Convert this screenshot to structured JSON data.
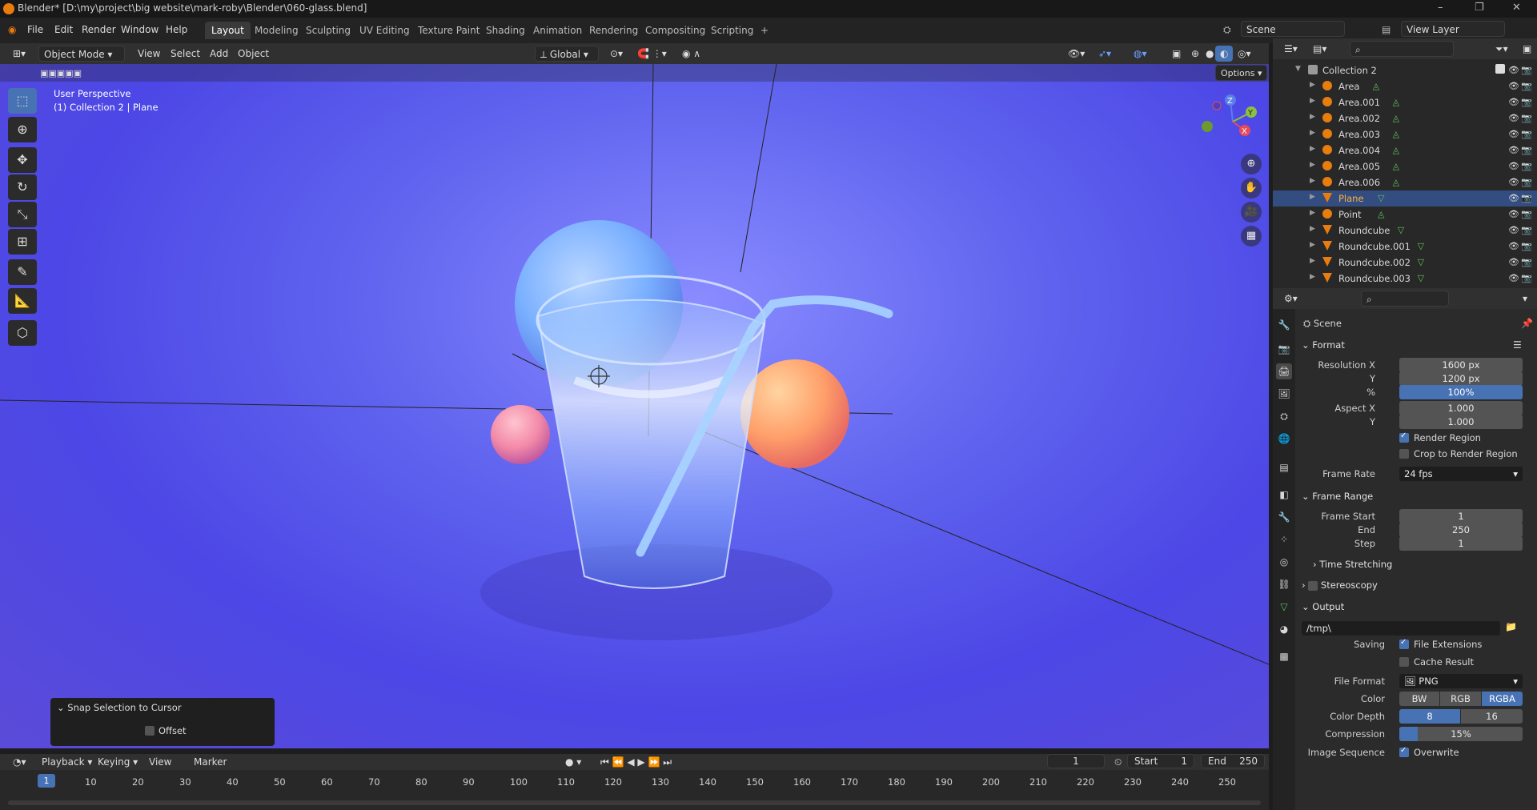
{
  "window": {
    "title": "Blender* [D:\\my\\project\\big website\\mark-roby\\Blender\\060-glass.blend]",
    "controls": [
      "–",
      "❐",
      "✕"
    ]
  },
  "menu": [
    "File",
    "Edit",
    "Render",
    "Window",
    "Help"
  ],
  "workspaces": [
    "Layout",
    "Modeling",
    "Sculpting",
    "UV Editing",
    "Texture Paint",
    "Shading",
    "Animation",
    "Rendering",
    "Compositing",
    "Scripting"
  ],
  "workspace_add": "+",
  "scene_name": "Scene",
  "view_layer": "View Layer",
  "viewport_header": {
    "mode": "Object Mode",
    "menus": [
      "View",
      "Select",
      "Add",
      "Object"
    ],
    "orientation": "Global",
    "options": "Options"
  },
  "viewport": {
    "perspective": "User Perspective",
    "context": "(1) Collection 2 | Plane",
    "gizmo": {
      "z": "Z",
      "y": "Y",
      "x": "X"
    }
  },
  "last_operation": {
    "title": "Snap Selection to Cursor",
    "option": "Offset"
  },
  "outliner": {
    "collection": "Collection 2",
    "items": [
      {
        "name": "Area",
        "type": "light",
        "selected": false
      },
      {
        "name": "Area.001",
        "type": "light",
        "selected": false
      },
      {
        "name": "Area.002",
        "type": "light",
        "selected": false
      },
      {
        "name": "Area.003",
        "type": "light",
        "selected": false
      },
      {
        "name": "Area.004",
        "type": "light",
        "selected": false
      },
      {
        "name": "Area.005",
        "type": "light",
        "selected": false
      },
      {
        "name": "Area.006",
        "type": "light",
        "selected": false
      },
      {
        "name": "Plane",
        "type": "mesh",
        "selected": true
      },
      {
        "name": "Point",
        "type": "light",
        "selected": false
      },
      {
        "name": "Roundcube",
        "type": "mesh",
        "selected": false
      },
      {
        "name": "Roundcube.001",
        "type": "mesh",
        "selected": false
      },
      {
        "name": "Roundcube.002",
        "type": "mesh",
        "selected": false
      },
      {
        "name": "Roundcube.003",
        "type": "mesh",
        "selected": false
      }
    ]
  },
  "properties": {
    "context": "Scene",
    "format": {
      "title": "Format",
      "resolution_x_label": "Resolution X",
      "resolution_x": "1600 px",
      "resolution_y_label": "Y",
      "resolution_y": "1200 px",
      "percent_label": "%",
      "percent": "100%",
      "aspect_x_label": "Aspect X",
      "aspect_x": "1.000",
      "aspect_y_label": "Y",
      "aspect_y": "1.000",
      "render_region": "Render Region",
      "crop_region": "Crop to Render Region",
      "frame_rate_label": "Frame Rate",
      "frame_rate": "24 fps"
    },
    "frame_range": {
      "title": "Frame Range",
      "start_label": "Frame Start",
      "start": "1",
      "end_label": "End",
      "end": "250",
      "step_label": "Step",
      "step": "1",
      "time_stretching": "Time Stretching"
    },
    "stereoscopy": "Stereoscopy",
    "output": {
      "title": "Output",
      "path": "/tmp\\",
      "saving_label": "Saving",
      "file_extensions": "File Extensions",
      "cache_result": "Cache Result",
      "file_format_label": "File Format",
      "file_format": "PNG",
      "color_label": "Color",
      "color_options": [
        "BW",
        "RGB",
        "RGBA"
      ],
      "color_selected": "RGBA",
      "color_depth_label": "Color Depth",
      "color_depth_options": [
        "8",
        "16"
      ],
      "color_depth_selected": "8",
      "compression_label": "Compression",
      "compression": "15%",
      "compression_value": 0.15,
      "image_sequence_label": "Image Sequence",
      "overwrite": "Overwrite"
    }
  },
  "timeline": {
    "menus": [
      "Playback",
      "Keying",
      "View",
      "Marker"
    ],
    "current_frame": "1",
    "start_label": "Start",
    "start": "1",
    "end_label": "End",
    "end": "250",
    "ticks": [
      "10",
      "20",
      "30",
      "40",
      "50",
      "60",
      "70",
      "80",
      "90",
      "100",
      "110",
      "120",
      "130",
      "140",
      "150",
      "160",
      "170",
      "180",
      "190",
      "200",
      "210",
      "220",
      "230",
      "240",
      "250"
    ],
    "playhead": "1"
  },
  "colors": {
    "accent": "#4772b3",
    "selection": "#334d80",
    "light_icon": "#e87d0d",
    "mesh_data": "#5fc35f"
  }
}
